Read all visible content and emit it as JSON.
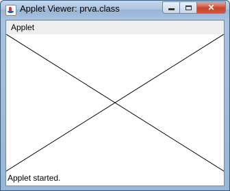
{
  "window": {
    "title": "Applet Viewer: prva.class",
    "controls": {
      "minimize": "minimize",
      "maximize": "maximize",
      "close": "close"
    }
  },
  "menubar": {
    "items": [
      {
        "label": "Applet"
      }
    ]
  },
  "status": {
    "text": "Applet started."
  },
  "colors": {
    "title_bar": "#a9c3e0",
    "close_button": "#c8472d",
    "menubar": "#eeeeee"
  },
  "icons": [
    "java-app-icon",
    "minimize-icon",
    "maximize-icon",
    "close-icon"
  ]
}
